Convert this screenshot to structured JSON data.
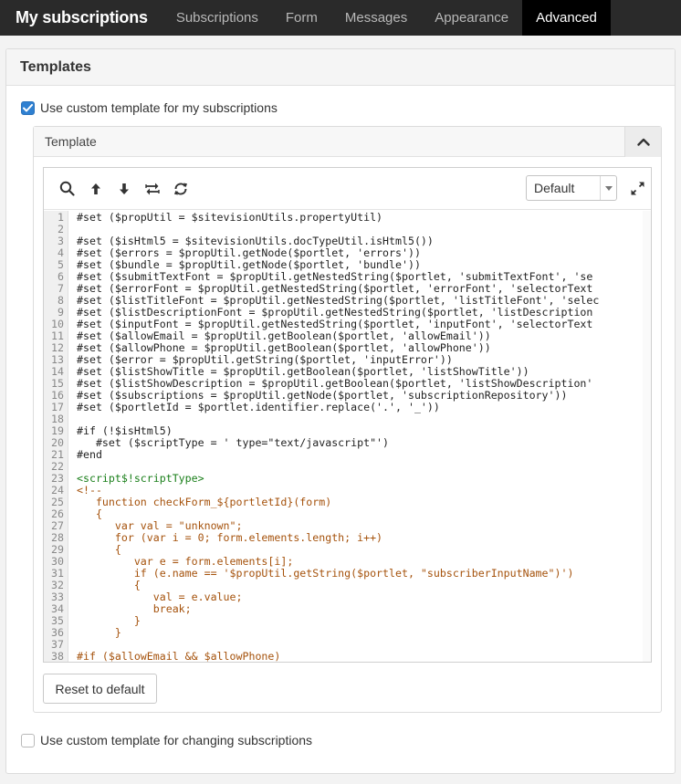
{
  "header": {
    "title": "My subscriptions",
    "tabs": [
      {
        "label": "Subscriptions"
      },
      {
        "label": "Form"
      },
      {
        "label": "Messages"
      },
      {
        "label": "Appearance"
      },
      {
        "label": "Advanced"
      }
    ],
    "active_tab": "Advanced"
  },
  "templates_panel": {
    "title": "Templates",
    "use_custom_my_subscriptions": {
      "label": "Use custom template for my subscriptions",
      "checked": true
    },
    "template_section": {
      "label": "Template"
    },
    "editor": {
      "toolbar": {
        "icons": [
          "search-icon",
          "arrow-up-icon",
          "arrow-down-icon",
          "replace-icon",
          "refresh-icon"
        ],
        "mode_select_value": "Default",
        "expand_icon": "expand-icon"
      },
      "code_lines": [
        {
          "n": "1",
          "t": "#set ($propUtil = $sitevisionUtils.propertyUtil)",
          "k": "v"
        },
        {
          "n": "2",
          "t": "",
          "k": "v"
        },
        {
          "n": "3",
          "t": "#set ($isHtml5 = $sitevisionUtils.docTypeUtil.isHtml5())",
          "k": "v"
        },
        {
          "n": "4",
          "t": "#set ($errors = $propUtil.getNode($portlet, 'errors'))",
          "k": "v"
        },
        {
          "n": "5",
          "t": "#set ($bundle = $propUtil.getNode($portlet, 'bundle'))",
          "k": "v"
        },
        {
          "n": "6",
          "t": "#set ($submitTextFont = $propUtil.getNestedString($portlet, 'submitTextFont', 'se",
          "k": "v"
        },
        {
          "n": "7",
          "t": "#set ($errorFont = $propUtil.getNestedString($portlet, 'errorFont', 'selectorText",
          "k": "v"
        },
        {
          "n": "8",
          "t": "#set ($listTitleFont = $propUtil.getNestedString($portlet, 'listTitleFont', 'selec",
          "k": "v"
        },
        {
          "n": "9",
          "t": "#set ($listDescriptionFont = $propUtil.getNestedString($portlet, 'listDescription",
          "k": "v"
        },
        {
          "n": "10",
          "t": "#set ($inputFont = $propUtil.getNestedString($portlet, 'inputFont', 'selectorText",
          "k": "v"
        },
        {
          "n": "11",
          "t": "#set ($allowEmail = $propUtil.getBoolean($portlet, 'allowEmail'))",
          "k": "v"
        },
        {
          "n": "12",
          "t": "#set ($allowPhone = $propUtil.getBoolean($portlet, 'allowPhone'))",
          "k": "v"
        },
        {
          "n": "13",
          "t": "#set ($error = $propUtil.getString($portlet, 'inputError'))",
          "k": "v"
        },
        {
          "n": "14",
          "t": "#set ($listShowTitle = $propUtil.getBoolean($portlet, 'listShowTitle'))",
          "k": "v"
        },
        {
          "n": "15",
          "t": "#set ($listShowDescription = $propUtil.getBoolean($portlet, 'listShowDescription'",
          "k": "v"
        },
        {
          "n": "16",
          "t": "#set ($subscriptions = $propUtil.getNode($portlet, 'subscriptionRepository'))",
          "k": "v"
        },
        {
          "n": "17",
          "t": "#set ($portletId = $portlet.identifier.replace('.', '_'))",
          "k": "v"
        },
        {
          "n": "18",
          "t": "",
          "k": "v"
        },
        {
          "n": "19",
          "t": "#if (!$isHtml5)",
          "k": "v"
        },
        {
          "n": "20",
          "t": "   #set ($scriptType = ' type=\"text/javascript\"')",
          "k": "v"
        },
        {
          "n": "21",
          "t": "#end",
          "k": "v"
        },
        {
          "n": "22",
          "t": "",
          "k": "v"
        },
        {
          "n": "23",
          "t": "<script$!scriptType>",
          "k": "html"
        },
        {
          "n": "24",
          "t": "<!--",
          "k": "js"
        },
        {
          "n": "25",
          "t": "   function checkForm_${portletId}(form)",
          "k": "js"
        },
        {
          "n": "26",
          "t": "   {",
          "k": "js"
        },
        {
          "n": "27",
          "t": "      var val = \"unknown\";",
          "k": "js"
        },
        {
          "n": "28",
          "t": "      for (var i = 0; form.elements.length; i++)",
          "k": "js"
        },
        {
          "n": "29",
          "t": "      {",
          "k": "js"
        },
        {
          "n": "30",
          "t": "         var e = form.elements[i];",
          "k": "js"
        },
        {
          "n": "31",
          "t": "         if (e.name == '$propUtil.getString($portlet, \"subscriberInputName\")')",
          "k": "js"
        },
        {
          "n": "32",
          "t": "         {",
          "k": "js"
        },
        {
          "n": "33",
          "t": "            val = e.value;",
          "k": "js"
        },
        {
          "n": "34",
          "t": "            break;",
          "k": "js"
        },
        {
          "n": "35",
          "t": "         }",
          "k": "js"
        },
        {
          "n": "36",
          "t": "      }",
          "k": "js"
        },
        {
          "n": "37",
          "t": "",
          "k": "js"
        },
        {
          "n": "38",
          "t": "#if ($allowEmail && $allowPhone)",
          "k": "js"
        }
      ]
    },
    "reset_button": "Reset to default",
    "use_custom_changing": {
      "label": "Use custom template for changing subscriptions",
      "checked": false
    }
  },
  "colors": {
    "topbar_bg": "#2a2a2a",
    "active_tab_bg": "#000000",
    "checkbox_blue": "#2f80d1",
    "code_html_green": "#1a7f1a",
    "code_js_brown": "#a5520c"
  }
}
